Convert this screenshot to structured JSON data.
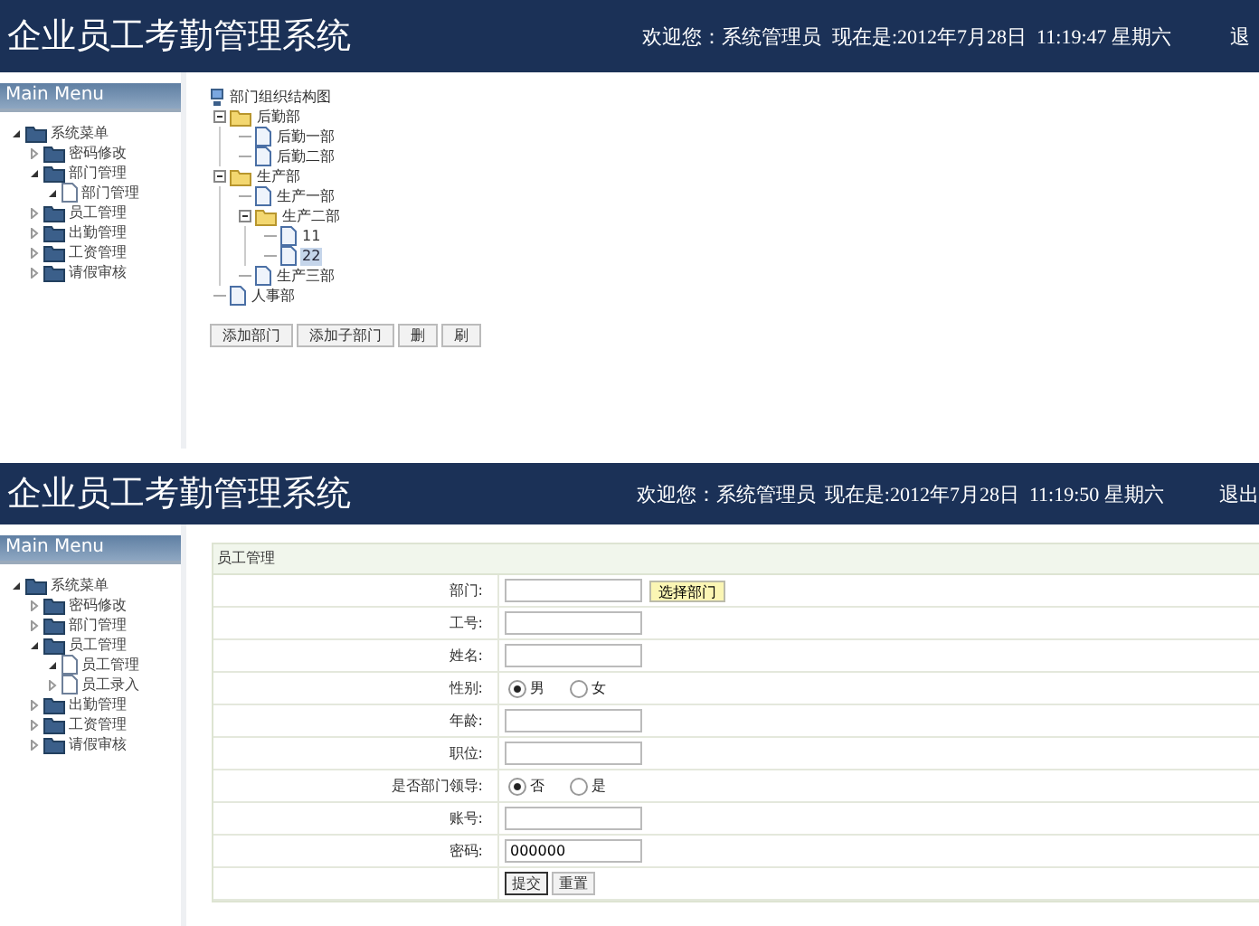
{
  "screens": [
    {
      "header": {
        "title": "企业员工考勤管理系统",
        "welcome": "欢迎您：系统管理员",
        "time": "现在是:2012年7月28日  11:19:47 星期六",
        "logout": "退"
      },
      "sidebar": {
        "heading": "Main Menu",
        "items": [
          {
            "label": "系统菜单",
            "kind": "folder",
            "expanded": true,
            "children": [
              {
                "label": "密码修改",
                "kind": "folder",
                "expanded": false
              },
              {
                "label": "部门管理",
                "kind": "folder",
                "expanded": true,
                "children": [
                  {
                    "label": "部门管理",
                    "kind": "page",
                    "expanded": true
                  }
                ]
              },
              {
                "label": "员工管理",
                "kind": "folder",
                "expanded": false
              },
              {
                "label": "出勤管理",
                "kind": "folder",
                "expanded": false
              },
              {
                "label": "工资管理",
                "kind": "folder",
                "expanded": false
              },
              {
                "label": "请假审核",
                "kind": "folder",
                "expanded": false
              }
            ]
          }
        ]
      },
      "content": {
        "kind": "department_tree",
        "root": "部门组织结构图",
        "nodes": [
          {
            "label": "后勤部",
            "kind": "folder",
            "selected": false,
            "children": [
              {
                "label": "后勤一部",
                "kind": "page",
                "selected": false
              },
              {
                "label": "后勤二部",
                "kind": "page",
                "selected": false
              }
            ]
          },
          {
            "label": "生产部",
            "kind": "folder",
            "selected": false,
            "children": [
              {
                "label": "生产一部",
                "kind": "page",
                "selected": false
              },
              {
                "label": "生产二部",
                "kind": "folder",
                "selected": false,
                "children": [
                  {
                    "label": "11",
                    "kind": "page",
                    "selected": false
                  },
                  {
                    "label": "22",
                    "kind": "page",
                    "selected": true
                  }
                ]
              },
              {
                "label": "生产三部",
                "kind": "page",
                "selected": false
              }
            ]
          },
          {
            "label": "人事部",
            "kind": "page",
            "selected": false
          }
        ],
        "buttons": [
          "添加部门",
          "添加子部门",
          "删",
          "刷"
        ]
      }
    },
    {
      "header": {
        "title": "企业员工考勤管理系统",
        "welcome": "欢迎您：系统管理员",
        "time": "现在是:2012年7月28日  11:19:50 星期六",
        "logout": "退出"
      },
      "sidebar": {
        "heading": "Main Menu",
        "items": [
          {
            "label": "系统菜单",
            "kind": "folder",
            "expanded": true,
            "children": [
              {
                "label": "密码修改",
                "kind": "folder",
                "expanded": false
              },
              {
                "label": "部门管理",
                "kind": "folder",
                "expanded": false
              },
              {
                "label": "员工管理",
                "kind": "folder",
                "expanded": true,
                "children": [
                  {
                    "label": "员工管理",
                    "kind": "page",
                    "expanded": true
                  },
                  {
                    "label": "员工录入",
                    "kind": "page",
                    "expanded": false
                  }
                ]
              },
              {
                "label": "出勤管理",
                "kind": "folder",
                "expanded": false
              },
              {
                "label": "工资管理",
                "kind": "folder",
                "expanded": false
              },
              {
                "label": "请假审核",
                "kind": "folder",
                "expanded": false
              }
            ]
          }
        ]
      },
      "content": {
        "kind": "employee_form",
        "title": "员工管理",
        "rows": [
          {
            "label": "部门:",
            "kind": "picker",
            "value": "",
            "button": "选择部门"
          },
          {
            "label": "工号:",
            "kind": "text",
            "value": ""
          },
          {
            "label": "姓名:",
            "kind": "text",
            "value": ""
          },
          {
            "label": "性别:",
            "kind": "radio",
            "options": [
              {
                "label": "男",
                "selected": true
              },
              {
                "label": "女",
                "selected": false
              }
            ]
          },
          {
            "label": "年龄:",
            "kind": "text",
            "value": ""
          },
          {
            "label": "职位:",
            "kind": "text",
            "value": ""
          },
          {
            "label": "是否部门领导:",
            "kind": "radio",
            "options": [
              {
                "label": "否",
                "selected": true
              },
              {
                "label": "是",
                "selected": false
              }
            ]
          },
          {
            "label": "账号:",
            "kind": "text",
            "value": ""
          },
          {
            "label": "密码:",
            "kind": "text",
            "value": "000000"
          }
        ],
        "buttons": [
          "提交",
          "重置"
        ]
      }
    }
  ]
}
